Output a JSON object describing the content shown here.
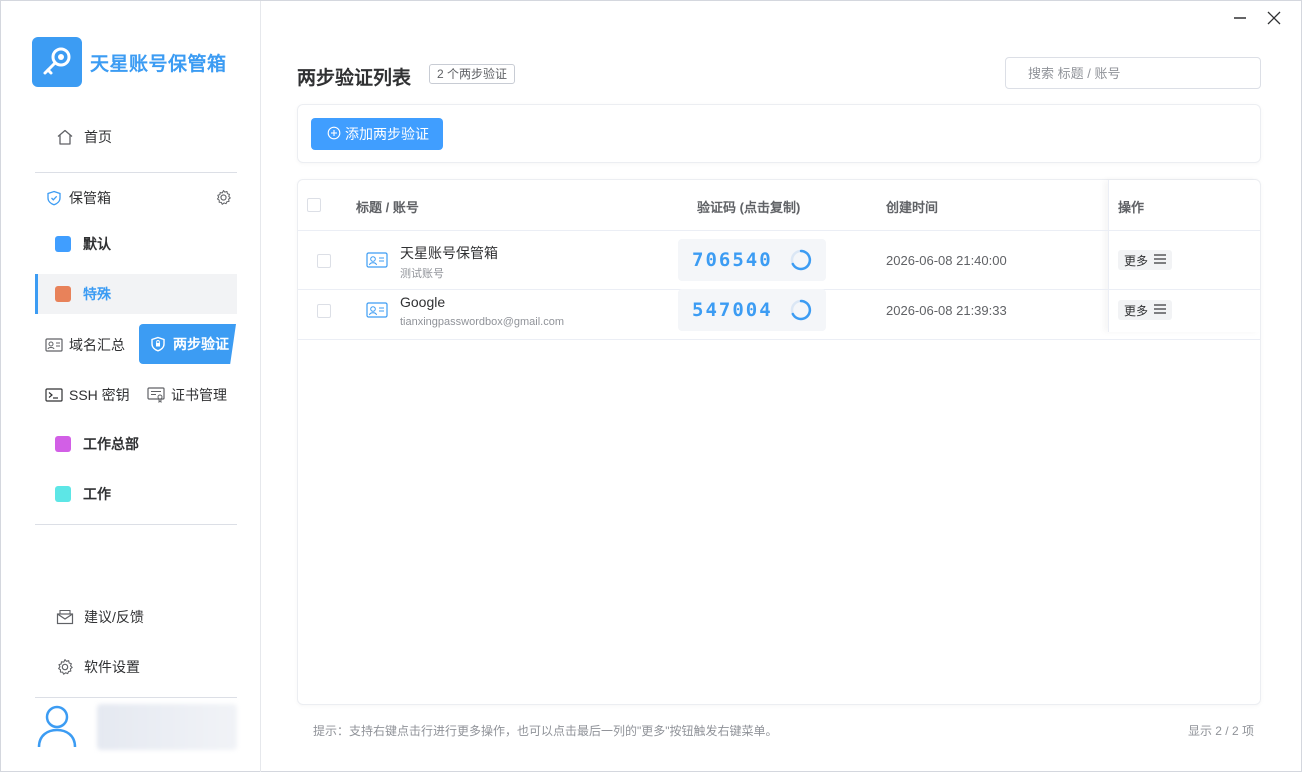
{
  "app": {
    "name": "天星账号保管箱"
  },
  "window": {
    "minimize_icon": "minimize-icon",
    "close_icon": "close-icon"
  },
  "sidebar": {
    "home": {
      "label": "首页",
      "icon": "home-icon"
    },
    "vault_header": {
      "label": "保管箱",
      "icon": "shield-icon",
      "settings_icon": "gear-icon"
    },
    "vaults": [
      {
        "label": "默认",
        "color": "#409eff"
      },
      {
        "label": "特殊",
        "color": "#e8825a",
        "active": true
      }
    ],
    "tools": {
      "domain": "域名汇总",
      "twofa": "两步验证",
      "ssh": "SSH 密钥",
      "cert": "证书管理"
    },
    "groups": [
      {
        "label": "工作总部",
        "color": "#d25fe6"
      },
      {
        "label": "工作",
        "color": "#5de6e6"
      }
    ],
    "feedback": {
      "label": "建议/反馈",
      "icon": "mail-icon"
    },
    "settings": {
      "label": "软件设置",
      "icon": "gear-icon"
    },
    "user": {
      "icon": "user-icon"
    }
  },
  "main": {
    "title": "两步验证列表",
    "count_tag": "2 个两步验证",
    "search_placeholder": "搜索 标题 / 账号",
    "add_button": "添加两步验证",
    "table": {
      "headers": {
        "title": "标题 / 账号",
        "code": "验证码 (点击复制)",
        "created": "创建时间",
        "actions": "操作"
      },
      "rows": [
        {
          "title": "天星账号保管箱",
          "account": "测试账号",
          "code": "706540",
          "created": "2026-06-08 21:40:00",
          "more": "更多"
        },
        {
          "title": "Google",
          "account": "tianxingpasswordbox@gmail.com",
          "code": "547004",
          "created": "2026-06-08 21:39:33",
          "more": "更多"
        }
      ]
    },
    "footer_hint": "提示：支持右键点击行进行更多操作，也可以点击最后一列的\"更多\"按钮触发右键菜单。",
    "footer_count": "显示 2 / 2 项"
  },
  "colors": {
    "accent": "#3c9cf3",
    "button": "#409eff"
  }
}
